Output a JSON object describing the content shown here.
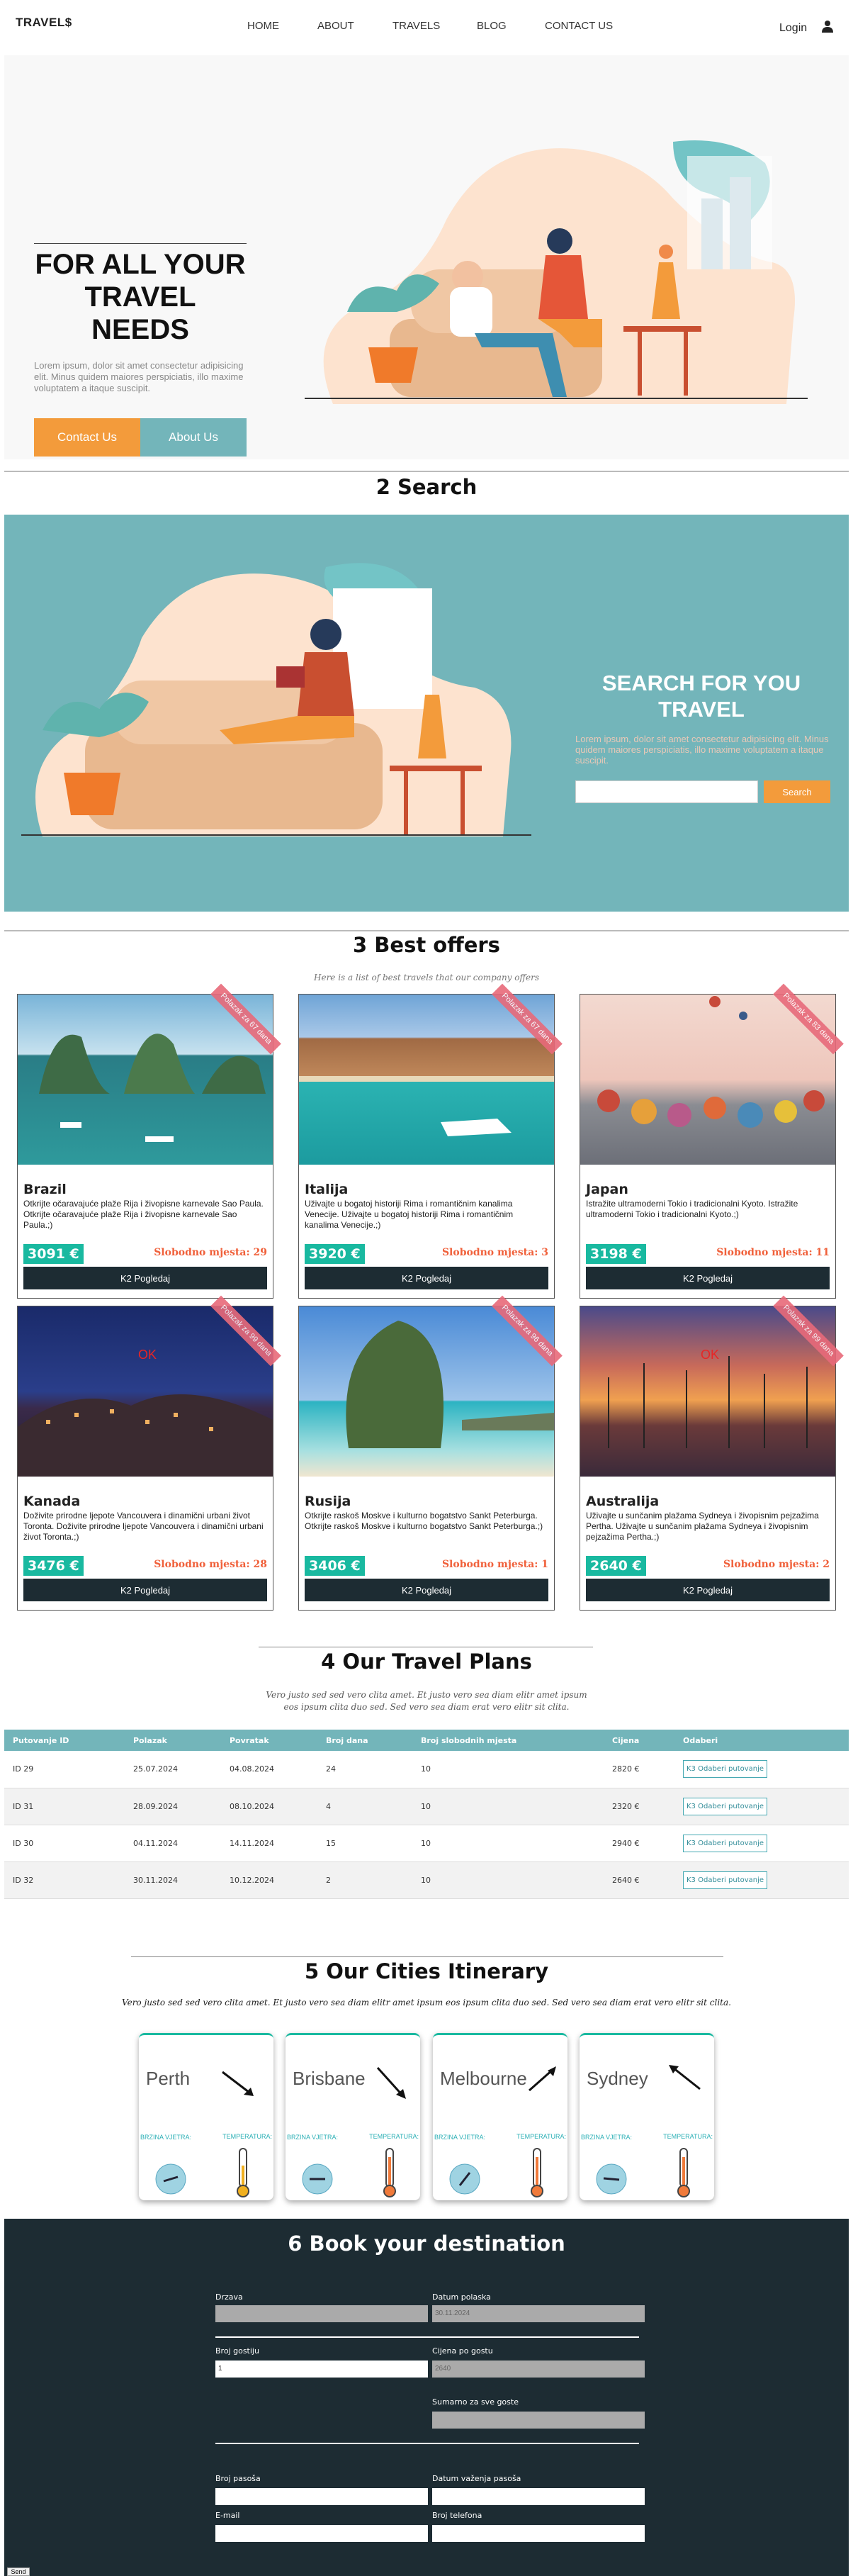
{
  "nav": {
    "logo": "TRAVEL$",
    "links": [
      "HOME",
      "ABOUT",
      "TRAVELS",
      "BLOG",
      "CONTACT US"
    ],
    "login": "Login"
  },
  "hero": {
    "title": "FOR ALL YOUR TRAVEL NEEDS",
    "text": "Lorem ipsum, dolor sit amet consectetur adipisicing elit. Minus quidem maiores perspiciatis, illo maxime voluptatem a itaque suscipit.",
    "contact_btn": "Contact Us",
    "about_btn": "About Us"
  },
  "search": {
    "section_title": "2 Search",
    "title": "SEARCH FOR YOU TRAVEL",
    "text": "Lorem ipsum, dolor sit amet consectetur adipisicing elit. Minus quidem maiores perspiciatis, illo maxime voluptatem a itaque suscipit.",
    "button": "Search"
  },
  "offers": {
    "section_title": "3 Best offers",
    "subtitle": "Here is a list of best travels that our company offers",
    "cards": [
      {
        "name": "Brazil",
        "desc": "Otkrijte očaravajuće plaže Rija i živopisne karnevale Sao Paula. Otkrijte očaravajuće plaže Rija i živopisne karnevale Sao Paula.;)",
        "price": "3091 €",
        "seats": "Slobodno mjesta: 29",
        "ribbon": "Polazak za 67 dana",
        "ok": "",
        "view": "K2 Pogledaj"
      },
      {
        "name": "Italija",
        "desc": "Uživajte u bogatoj historiji Rima i romantičnim kanalima Venecije. Uživajte u bogatoj historiji Rima i romantičnim kanalima Venecije.;)",
        "price": "3920 €",
        "seats": "Slobodno mjesta: 3",
        "ribbon": "Polazak za 67 dana",
        "ok": "",
        "view": "K2 Pogledaj"
      },
      {
        "name": "Japan",
        "desc": "Istražite ultramoderni Tokio i tradicionalni Kyoto. Istražite ultramoderni Tokio i tradicionalni Kyoto.;)",
        "price": "3198 €",
        "seats": "Slobodno mjesta: 11",
        "ribbon": "Polazak za 83 dana",
        "ok": "",
        "view": "K2 Pogledaj"
      },
      {
        "name": "Kanada",
        "desc": "Doživite prirodne ljepote Vancouvera i dinamični urbani život Toronta. Doživite prirodne ljepote Vancouvera i dinamični urbani život Toronta.;)",
        "price": "3476 €",
        "seats": "Slobodno mjesta: 28",
        "ribbon": "Polazak za 99 dana",
        "ok": "OK",
        "view": "K2 Pogledaj"
      },
      {
        "name": "Rusija",
        "desc": "Otkrijte raskoš Moskve i kulturno bogatstvo Sankt Peterburga. Otkrijte raskoš Moskve i kulturno bogatstvo Sankt Peterburga.;)",
        "price": "3406 €",
        "seats": "Slobodno mjesta: 1",
        "ribbon": "Polazak za 96 dana",
        "ok": "",
        "view": "K2 Pogledaj"
      },
      {
        "name": "Australija",
        "desc": "Uživajte u sunčanim plažama Sydneya i živopisnim pejzažima Pertha. Uživajte u sunčanim plažama Sydneya i živopisnim pejzažima Pertha.;)",
        "price": "2640 €",
        "seats": "Slobodno mjesta: 2",
        "ribbon": "Polazak za 99 dana",
        "ok": "OK",
        "view": "K2 Pogledaj"
      }
    ]
  },
  "plans": {
    "section_title": "4 Our Travel Plans",
    "subtitle": "Vero justo sed sed vero clita amet. Et justo vero sea diam elitr amet ipsum eos ipsum clita duo sed. Sed vero sea diam erat vero elitr sit clita.",
    "headers": [
      "Putovanje ID",
      "Polazak",
      "Povratak",
      "Broj dana",
      "Broj slobodnih mjesta",
      "Cijena",
      "Odaberi"
    ],
    "rows": [
      [
        "ID 29",
        "25.07.2024",
        "04.08.2024",
        "24",
        "10",
        "2820 €",
        "K3 Odaberi putovanje"
      ],
      [
        "ID 31",
        "28.09.2024",
        "08.10.2024",
        "4",
        "10",
        "2320 €",
        "K3 Odaberi putovanje"
      ],
      [
        "ID 30",
        "04.11.2024",
        "14.11.2024",
        "15",
        "10",
        "2940 €",
        "K3 Odaberi putovanje"
      ],
      [
        "ID 32",
        "30.11.2024",
        "10.12.2024",
        "2",
        "10",
        "2640 €",
        "K3 Odaberi putovanje"
      ]
    ]
  },
  "cities": {
    "section_title": "5 Our Cities Itinerary",
    "subtitle": "Vero justo sed sed vero clita amet. Et justo vero sea diam elitr amet ipsum eos ipsum clita duo sed. Sed vero sea diam erat vero elitr sit clita.",
    "wind_label": "BRZINA VJETRA:",
    "temp_label": "TEMPERATURA:",
    "items": [
      {
        "name": "Perth",
        "arrow": "down-right"
      },
      {
        "name": "Brisbane",
        "arrow": "down-right"
      },
      {
        "name": "Melbourne",
        "arrow": "up-right"
      },
      {
        "name": "Sydney",
        "arrow": "up-left"
      }
    ]
  },
  "book": {
    "section_title": "6 Book your destination",
    "fields": {
      "drzava": "Drzava",
      "datum_polaska": "Datum polaska",
      "datum_polaska_value": "30.11.2024",
      "broj_gostiju": "Broj gostiju",
      "broj_gostiju_value": "1",
      "cijena_po_gostu": "Cijena po gostu",
      "cijena_po_gostu_value": "2640",
      "sumarno": "Sumarno za sve goste",
      "broj_pasosa": "Broj pasoša",
      "datum_vazenja": "Datum važenja pasoša",
      "email": "E-mail",
      "broj_telefona": "Broj telefona"
    },
    "send": "Send"
  },
  "colors": {
    "accent_orange": "#f39b3b",
    "accent_teal": "#73b5ba",
    "dark": "#1d2c33",
    "price_green": "#19b9a0"
  }
}
